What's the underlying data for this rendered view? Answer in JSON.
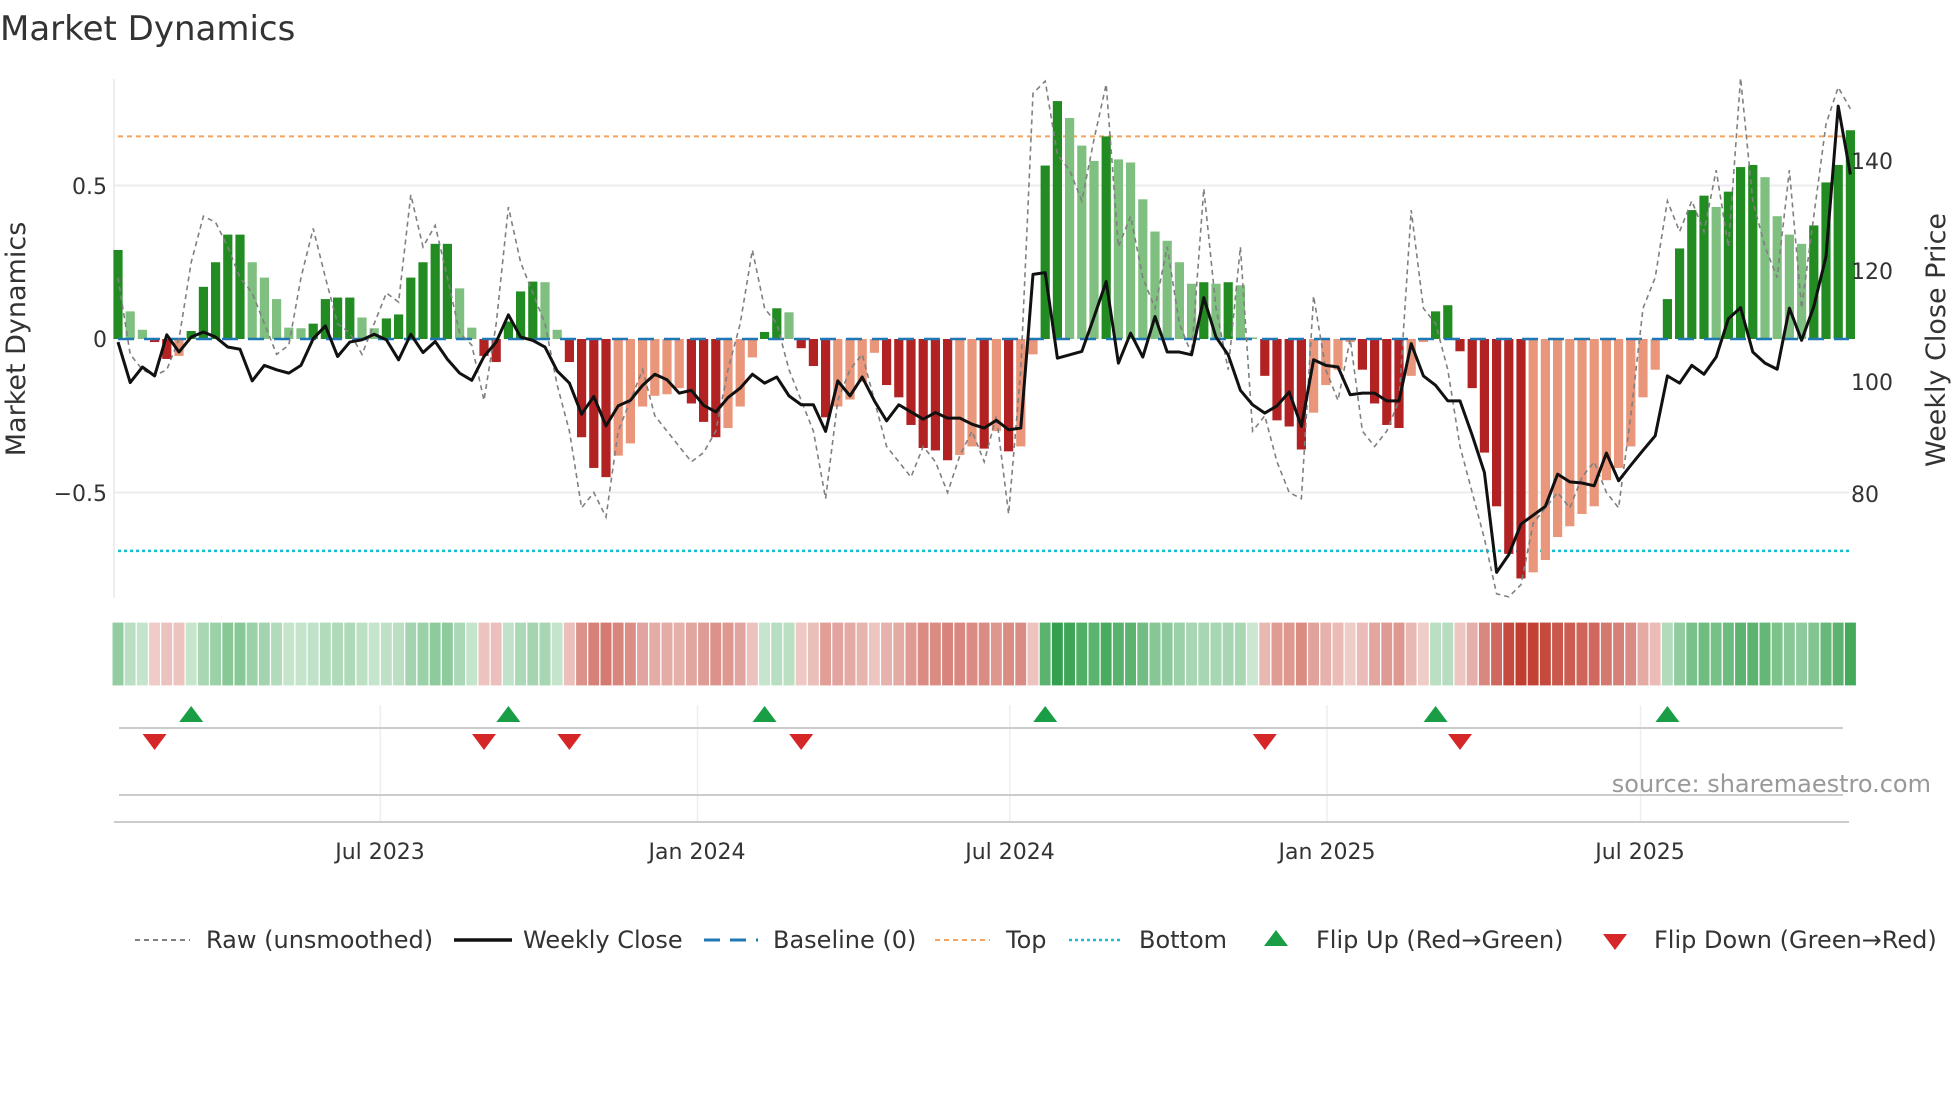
{
  "chart_data": {
    "type": "bar",
    "title": "Market Dynamics",
    "ylabel": "Market Dynamics",
    "y2label": "Weekly Close Price",
    "ylim": [
      -0.88,
      0.88
    ],
    "y2lim": [
      68,
      155
    ],
    "yticks": [
      {
        "label": "0.5",
        "value": 0.5
      },
      {
        "label": "0",
        "value": 0
      },
      {
        "label": "−0.5",
        "value": -0.5
      }
    ],
    "y2ticks": [
      {
        "label": "140",
        "value": 140
      },
      {
        "label": "120",
        "value": 120
      },
      {
        "label": "100",
        "value": 100
      },
      {
        "label": "80",
        "value": 80
      }
    ],
    "xticks": [
      {
        "label": "Jul 2023",
        "week": 21.5
      },
      {
        "label": "Jan 2024",
        "week": 47.5
      },
      {
        "label": "Jul 2024",
        "week": 73.1
      },
      {
        "label": "Jan 2025",
        "week": 99.1
      },
      {
        "label": "Jul 2025",
        "week": 124.8
      }
    ],
    "top_threshold": 0.66,
    "bottom_threshold": -0.69,
    "baseline": 0,
    "smoothed": [
      0.29,
      0.09,
      0.03,
      -0.01,
      -0.065,
      -0.055,
      0.026,
      0.17,
      0.25,
      0.34,
      0.34,
      0.25,
      0.2,
      0.13,
      0.037,
      0.035,
      0.05,
      0.13,
      0.135,
      0.135,
      0.07,
      0.035,
      0.067,
      0.08,
      0.2,
      0.25,
      0.31,
      0.31,
      0.165,
      0.037,
      -0.055,
      -0.075,
      0.057,
      0.155,
      0.187,
      0.185,
      0.03,
      -0.075,
      -0.32,
      -0.42,
      -0.45,
      -0.38,
      -0.34,
      -0.22,
      -0.185,
      -0.18,
      -0.16,
      -0.21,
      -0.27,
      -0.32,
      -0.29,
      -0.22,
      -0.06,
      0.023,
      0.1,
      0.087,
      -0.03,
      -0.088,
      -0.255,
      -0.22,
      -0.197,
      -0.14,
      -0.045,
      -0.15,
      -0.19,
      -0.28,
      -0.355,
      -0.363,
      -0.395,
      -0.378,
      -0.35,
      -0.357,
      -0.3,
      -0.366,
      -0.35,
      -0.05,
      0.565,
      0.775,
      0.72,
      0.63,
      0.58,
      0.66,
      0.585,
      0.575,
      0.455,
      0.35,
      0.32,
      0.25,
      0.18,
      0.185,
      0.18,
      0.185,
      0.175,
      0.005,
      -0.12,
      -0.265,
      -0.285,
      -0.36,
      -0.24,
      -0.15,
      -0.1,
      -0.01,
      -0.1,
      -0.21,
      -0.28,
      -0.29,
      -0.12,
      -0.01,
      0.09,
      0.11,
      -0.04,
      -0.16,
      -0.37,
      -0.545,
      -0.7,
      -0.78,
      -0.76,
      -0.72,
      -0.645,
      -0.61,
      -0.57,
      -0.545,
      -0.46,
      -0.42,
      -0.35,
      -0.19,
      -0.1,
      0.13,
      0.295,
      0.42,
      0.467,
      0.43,
      0.48,
      0.56,
      0.567,
      0.527,
      0.4,
      0.34,
      0.31,
      0.37,
      0.51,
      0.567,
      0.68
    ],
    "raw": [
      0.2,
      -0.05,
      -0.1,
      -0.12,
      -0.1,
      0.0,
      0.25,
      0.4,
      0.38,
      0.3,
      0.2,
      0.15,
      0.05,
      -0.05,
      -0.02,
      0.2,
      0.36,
      0.2,
      0.05,
      0.02,
      -0.05,
      0.05,
      0.15,
      0.12,
      0.47,
      0.3,
      0.37,
      0.2,
      0.02,
      -0.02,
      -0.2,
      0.05,
      0.43,
      0.25,
      0.15,
      0.05,
      -0.15,
      -0.3,
      -0.55,
      -0.5,
      -0.58,
      -0.3,
      -0.2,
      -0.1,
      -0.25,
      -0.3,
      -0.35,
      -0.4,
      -0.37,
      -0.3,
      -0.1,
      0.05,
      0.29,
      0.1,
      0.05,
      -0.1,
      -0.2,
      -0.3,
      -0.52,
      -0.2,
      -0.1,
      -0.05,
      -0.2,
      -0.35,
      -0.4,
      -0.45,
      -0.35,
      -0.4,
      -0.5,
      -0.38,
      -0.3,
      -0.4,
      -0.25,
      -0.57,
      -0.1,
      0.8,
      0.84,
      0.6,
      0.55,
      0.45,
      0.65,
      0.83,
      0.3,
      0.4,
      0.2,
      0.1,
      0.3,
      0.05,
      -0.05,
      0.49,
      0.1,
      -0.1,
      0.3,
      -0.3,
      -0.25,
      -0.4,
      -0.5,
      -0.52,
      0.14,
      -0.1,
      -0.2,
      0.0,
      -0.3,
      -0.35,
      -0.3,
      -0.2,
      0.42,
      0.1,
      0.05,
      -0.1,
      -0.35,
      -0.5,
      -0.65,
      -0.83,
      -0.84,
      -0.8,
      -0.6,
      -0.55,
      -0.5,
      -0.55,
      -0.45,
      -0.4,
      -0.5,
      -0.55,
      -0.25,
      0.1,
      0.2,
      0.45,
      0.35,
      0.45,
      0.35,
      0.55,
      0.3,
      0.85,
      0.45,
      0.3,
      0.2,
      0.55,
      0.1,
      0.4,
      0.7,
      0.82,
      0.75
    ],
    "weekly_close": [
      107.2,
      99.9,
      102.7,
      101.1,
      108.5,
      105.4,
      108.1,
      109.0,
      108.1,
      106.3,
      105.9,
      100.2,
      103.0,
      102.2,
      101.6,
      103.0,
      107.8,
      110.1,
      104.6,
      107.2,
      107.6,
      108.6,
      107.6,
      104.0,
      108.6,
      105.3,
      107.3,
      104.1,
      101.6,
      100.3,
      104.6,
      107.2,
      112.1,
      108.1,
      107.5,
      106.3,
      102.0,
      99.8,
      94.2,
      97.4,
      92.1,
      95.7,
      96.7,
      99.4,
      101.4,
      100.4,
      98.0,
      98.5,
      95.8,
      94.6,
      97.2,
      98.9,
      101.4,
      99.8,
      100.9,
      97.5,
      95.9,
      95.9,
      91.1,
      100.2,
      97.5,
      100.9,
      96.6,
      93.0,
      95.9,
      94.6,
      93.3,
      94.5,
      93.5,
      93.5,
      92.4,
      91.7,
      93.1,
      91.4,
      91.7,
      119.4,
      119.7,
      104.3,
      104.9,
      105.5,
      111.7,
      118.1,
      103.4,
      108.8,
      104.5,
      111.8,
      105.4,
      105.4,
      104.9,
      115.2,
      108.1,
      104.9,
      98.5,
      95.9,
      94.4,
      95.7,
      98.2,
      92.0,
      104.0,
      103.0,
      102.7,
      97.7,
      98.0,
      98.0,
      96.6,
      96.6,
      106.9,
      101.1,
      99.4,
      96.6,
      96.6,
      90.4,
      83.7,
      65.7,
      68.9,
      74.4,
      76.0,
      77.6,
      83.4,
      82.0,
      81.8,
      81.3,
      87.2,
      82.2,
      85.0,
      87.7,
      90.3,
      101.1,
      99.8,
      103.0,
      101.4,
      104.5,
      111.4,
      113.4,
      105.4,
      103.4,
      102.3,
      113.3,
      107.5,
      113.6,
      122.6,
      149.7,
      137.4
    ],
    "flip_up_weeks": [
      6,
      32,
      53,
      76,
      108,
      127
    ],
    "flip_down_weeks": [
      3,
      30,
      37,
      56,
      94,
      110
    ],
    "legend": {
      "raw": "Raw (unsmoothed)",
      "close": "Weekly Close",
      "baseline": "Baseline (0)",
      "top": "Top",
      "bottom": "Bottom",
      "flip_up": "Flip Up (Red→Green)",
      "flip_down": "Flip Down (Green→Red)"
    },
    "legend_placement": "bottom",
    "source": "source: sharemaestro.com",
    "colors": {
      "green_dark": "#228b22",
      "green_light": "#7fbf7f",
      "red_dark": "#b22222",
      "red_light": "#e9967a",
      "close": "#111111",
      "raw": "#808080",
      "baseline": "#1f77b4",
      "top": "#f4a460",
      "bottom": "#17becf",
      "flip_up": "#1a9e45",
      "flip_down": "#d62728"
    }
  }
}
